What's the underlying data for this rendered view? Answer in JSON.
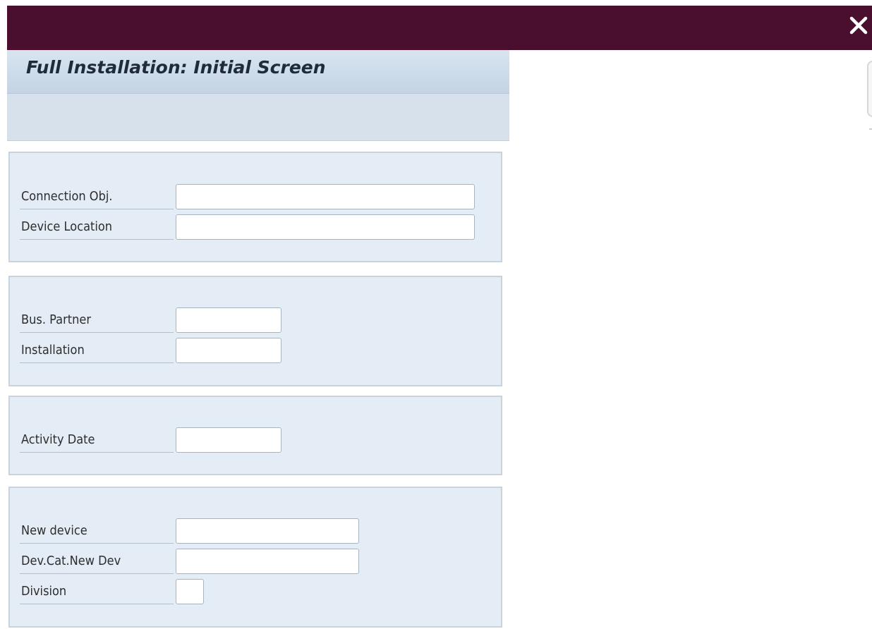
{
  "window": {
    "close_glyph": "✕",
    "close_icon": "close-icon",
    "titlebar_color": "#4a0f2e"
  },
  "header": {
    "title": "Full Installation: Initial Screen"
  },
  "groups": {
    "connection": {
      "connection_obj": {
        "label": "Connection Obj.",
        "value": ""
      },
      "device_location": {
        "label": "Device Location",
        "value": ""
      }
    },
    "partner": {
      "bus_partner": {
        "label": "Bus. Partner",
        "value": ""
      },
      "installation": {
        "label": "Installation",
        "value": ""
      }
    },
    "activity": {
      "activity_date": {
        "label": "Activity Date",
        "value": ""
      }
    },
    "device": {
      "new_device": {
        "label": "New device",
        "value": ""
      },
      "dev_cat_new_dev": {
        "label": "Dev.Cat.New Dev",
        "value": ""
      },
      "division": {
        "label": "Division",
        "value": ""
      }
    }
  }
}
